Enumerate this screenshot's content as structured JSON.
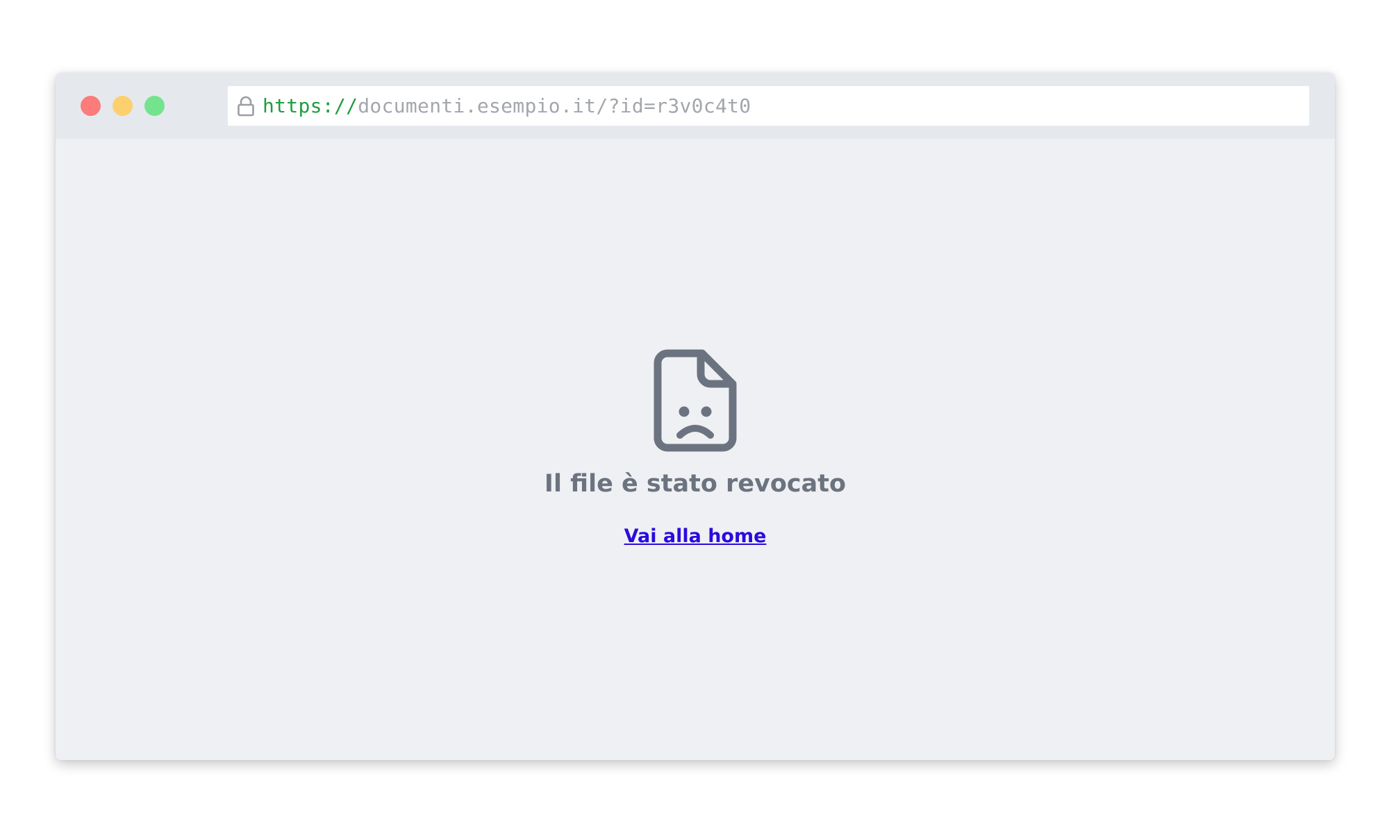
{
  "browser": {
    "url_scheme": "https://",
    "url_rest": "documenti.esempio.it/?id=r3v0c4t0",
    "traffic_lights": {
      "close_color": "#fc7b7b",
      "minimize_color": "#fdcf6e",
      "maximize_color": "#74e38e"
    },
    "icons": {
      "lock": "lock-icon"
    }
  },
  "page": {
    "icon": "file-sad-icon",
    "title": "Il file è stato revocato",
    "home_link_label": "Vai alla home",
    "colors": {
      "icon": "#6c7380",
      "title": "#6c7380",
      "link": "#2a0bde",
      "background": "#eff0f3"
    }
  }
}
